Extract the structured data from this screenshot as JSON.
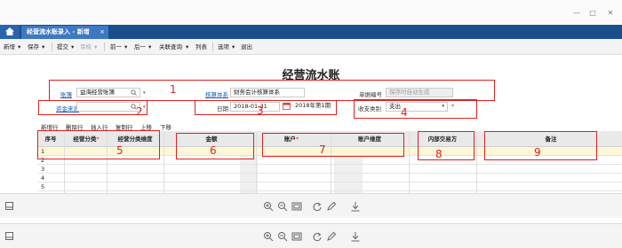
{
  "window": {
    "min": "—",
    "max": "□",
    "close": "✕"
  },
  "tabs": {
    "home_icon": "home-icon",
    "document": "经营流水账录入 - 新增",
    "close": "×"
  },
  "toolbar": {
    "new": "新增",
    "save": "保存",
    "submit": "提交",
    "audit": "审核",
    "prev": "前一",
    "next": "后一",
    "related": "关联查询",
    "list": "列表",
    "options": "选项",
    "exit": "退出",
    "dropdown_caret": "▾"
  },
  "page_title": "经营流水账",
  "form": {
    "ledger_label": "账簿",
    "ledger_value": "益海经营账簿",
    "accounting_system_label": "核算体系",
    "accounting_system_value": "财务会计核算体系",
    "doc_number_label": "单据编号",
    "doc_number_placeholder": "保存时自动生成",
    "source_label": "资金来源",
    "source_value": "",
    "date_label": "日期",
    "date_value": "2018-01-31",
    "period_value": "2018年第1期",
    "income_expense_label": "收支类别",
    "income_expense_value": "支出",
    "required_mark": "*"
  },
  "grid_toolbar": {
    "add_row": "新增行",
    "delete_row": "删除行",
    "insert_row": "插入行",
    "copy_row": "复制行",
    "move_up": "上移",
    "move_down": "下移"
  },
  "table": {
    "headers": {
      "seq": "序号",
      "category": "经营分类",
      "category_dim": "经营分类维度",
      "amount": "金额",
      "account": "账户",
      "account_dim": "账户维度",
      "internal_party": "内部交易方",
      "remark": "备注"
    },
    "required_mark": "*",
    "rows": [
      "1",
      "2",
      "3",
      "4",
      "5"
    ]
  },
  "annotations": [
    "1",
    "2",
    "3",
    "4",
    "5",
    "6",
    "7",
    "8",
    "9"
  ],
  "colors": {
    "tab_bar": "#1c4e8c",
    "active_tab": "#3d78c4",
    "annotation_red": "#e02020",
    "link": "#1a5fb4"
  }
}
